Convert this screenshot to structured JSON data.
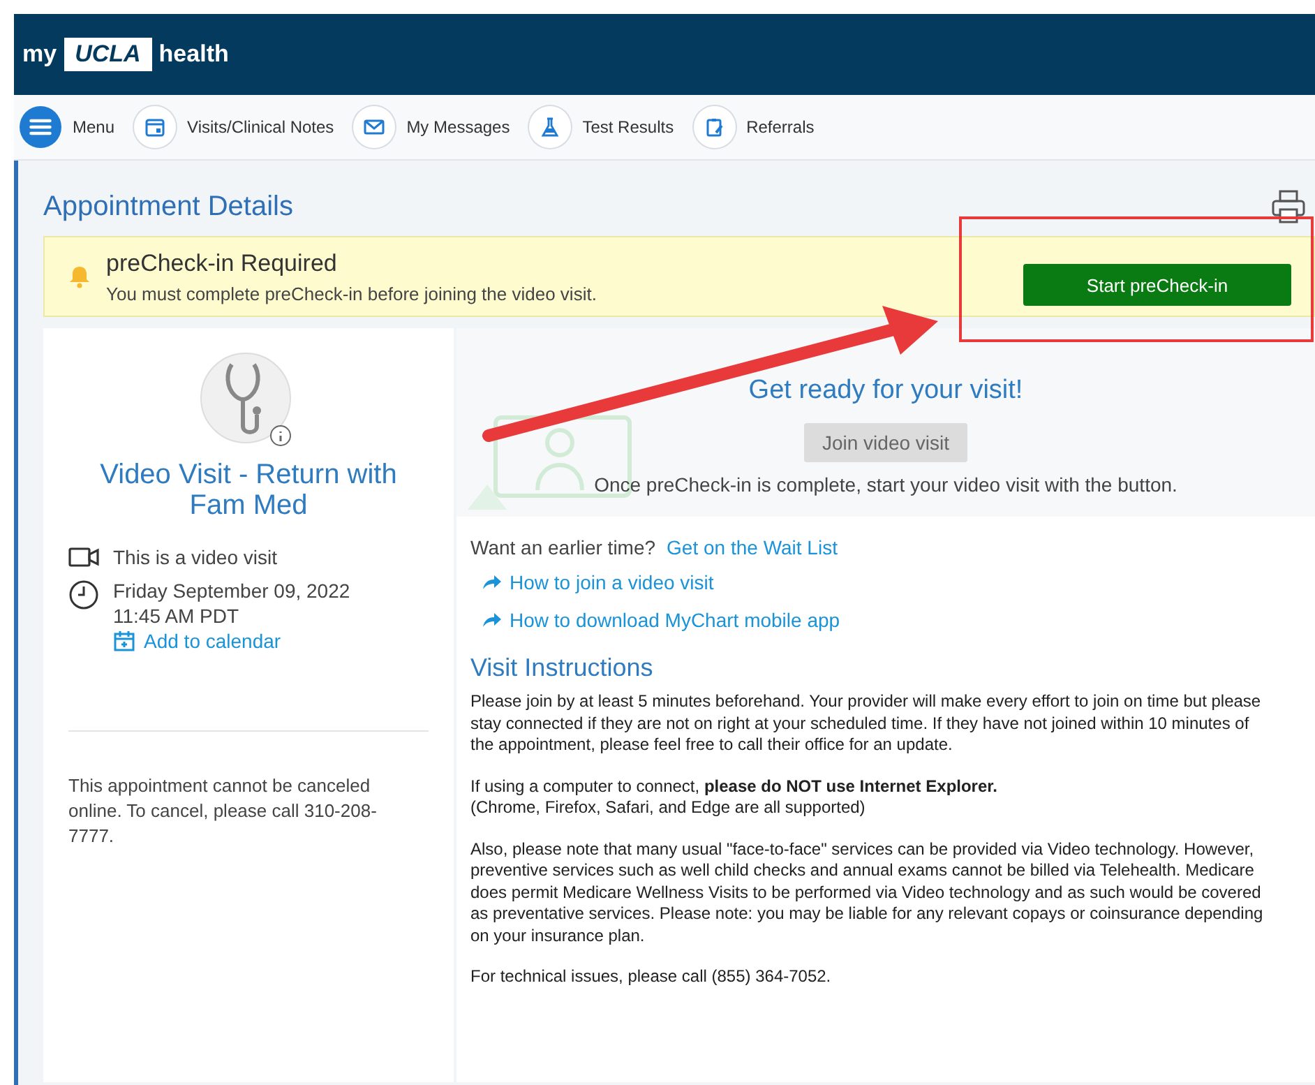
{
  "brand": {
    "prefix": "my",
    "badge": "UCLA",
    "suffix": "health"
  },
  "nav": [
    {
      "label": "Menu",
      "kind": "menu"
    },
    {
      "label": "Visits/Clinical Notes",
      "kind": "calendar"
    },
    {
      "label": "My Messages",
      "kind": "mail"
    },
    {
      "label": "Test Results",
      "kind": "flask"
    },
    {
      "label": "Referrals",
      "kind": "clipboard"
    }
  ],
  "page_title": "Appointment Details",
  "alert": {
    "title": "preCheck-in Required",
    "message": "You must complete preCheck-in before joining the video visit.",
    "button": "Start preCheck-in"
  },
  "visit": {
    "title": "Video Visit - Return with Fam Med",
    "type": "This is a video visit",
    "date": "Friday September 09, 2022",
    "time": "11:45 AM PDT",
    "calendar_link": "Add to calendar",
    "cancel_note": "This appointment cannot be canceled online. To cancel, please call 310-208-7777."
  },
  "ready": {
    "heading": "Get ready for your visit!",
    "button": {
      "label": "Join video visit",
      "disabled": true
    },
    "note": "Once preCheck-in is complete, start your video visit with the button."
  },
  "wait_list": {
    "prompt": "Want an earlier time?",
    "link": "Get on the Wait List"
  },
  "links": [
    "How to join a video visit",
    "How to download MyChart mobile app"
  ],
  "instructions": {
    "heading": "Visit Instructions",
    "paragraphs": [
      [
        "Please join by at least 5 minutes beforehand. Your provider will make every effort to join on time but please stay connected if they are not on right at your scheduled time. If they have not joined within 10 minutes of the appointment, please feel free to call their office for an update."
      ],
      [
        "If using a computer to connect, **please do NOT use Internet Explorer.**",
        "(Chrome, Firefox, Safari, and Edge are all supported)"
      ],
      [
        "Also, please note that many usual \"face-to-face\" services can be provided via Video technology. However, preventive services such as well child checks and annual exams cannot be billed via Telehealth. Medicare does permit Medicare Wellness Visits to be performed via Video technology and as such would be covered as preventative services. Please note: you may be liable for any relevant copays or coinsurance depending on your insurance plan."
      ],
      [
        "For technical issues, please call (855) 364-7052."
      ]
    ]
  }
}
